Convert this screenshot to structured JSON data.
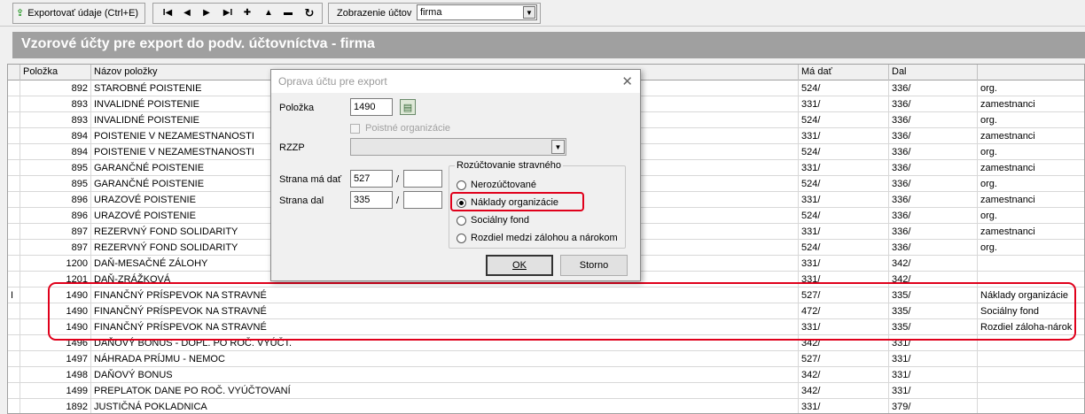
{
  "toolbar": {
    "export_label": "Exportovať údaje (Ctrl+E)",
    "nav_first": "I◀",
    "nav_prev": "◀",
    "nav_next": "▶",
    "nav_last": "▶I",
    "nav_add": "✚",
    "nav_up": "▲",
    "nav_remove": "▬",
    "nav_refresh": "↻",
    "view_label": "Zobrazenie účtov",
    "view_value": "firma"
  },
  "title": "Vzorové účty pre export do podv. účtovníctva - firma",
  "grid": {
    "headers": [
      "Položka",
      "Názov položky",
      "Má dať",
      "Dal",
      ""
    ],
    "rows": [
      {
        "marker": "",
        "item": "892",
        "name": "STAROBNÉ POISTENIE",
        "debit": "524/",
        "credit": "336/",
        "note": "org."
      },
      {
        "marker": "",
        "item": "893",
        "name": "INVALIDNÉ POISTENIE",
        "debit": "331/",
        "credit": "336/",
        "note": "zamestnanci"
      },
      {
        "marker": "",
        "item": "893",
        "name": "INVALIDNÉ POISTENIE",
        "debit": "524/",
        "credit": "336/",
        "note": "org."
      },
      {
        "marker": "",
        "item": "894",
        "name": "POISTENIE V NEZAMESTNANOSTI",
        "debit": "331/",
        "credit": "336/",
        "note": "zamestnanci"
      },
      {
        "marker": "",
        "item": "894",
        "name": "POISTENIE V NEZAMESTNANOSTI",
        "debit": "524/",
        "credit": "336/",
        "note": "org."
      },
      {
        "marker": "",
        "item": "895",
        "name": "GARANČNÉ POISTENIE",
        "debit": "331/",
        "credit": "336/",
        "note": "zamestnanci"
      },
      {
        "marker": "",
        "item": "895",
        "name": "GARANČNÉ POISTENIE",
        "debit": "524/",
        "credit": "336/",
        "note": "org."
      },
      {
        "marker": "",
        "item": "896",
        "name": "URAZOVÉ POISTENIE",
        "debit": "331/",
        "credit": "336/",
        "note": "zamestnanci"
      },
      {
        "marker": "",
        "item": "896",
        "name": "URAZOVÉ POISTENIE",
        "debit": "524/",
        "credit": "336/",
        "note": "org."
      },
      {
        "marker": "",
        "item": "897",
        "name": "REZERVNÝ FOND SOLIDARITY",
        "debit": "331/",
        "credit": "336/",
        "note": "zamestnanci"
      },
      {
        "marker": "",
        "item": "897",
        "name": "REZERVNÝ FOND SOLIDARITY",
        "debit": "524/",
        "credit": "336/",
        "note": "org."
      },
      {
        "marker": "",
        "item": "1200",
        "name": "DAŇ-MESAČNÉ ZÁLOHY",
        "debit": "331/",
        "credit": "342/",
        "note": ""
      },
      {
        "marker": "",
        "item": "1201",
        "name": "DAŇ-ZRÁŽKOVÁ",
        "debit": "331/",
        "credit": "342/",
        "note": ""
      },
      {
        "marker": "I",
        "item": "1490",
        "name": "FINANČNÝ PRÍSPEVOK NA STRAVNÉ",
        "debit": "527/",
        "credit": "335/",
        "note": "Náklady organizácie"
      },
      {
        "marker": "",
        "item": "1490",
        "name": "FINANČNÝ PRÍSPEVOK NA STRAVNÉ",
        "debit": "472/",
        "credit": "335/",
        "note": "Sociálny fond"
      },
      {
        "marker": "",
        "item": "1490",
        "name": "FINANČNÝ PRÍSPEVOK NA STRAVNÉ",
        "debit": "331/",
        "credit": "335/",
        "note": "Rozdiel záloha-nárok"
      },
      {
        "marker": "",
        "item": "1496",
        "name": "DAŇOVÝ BONUS - DOPL. PO ROČ. VYÚČT.",
        "debit": "342/",
        "credit": "331/",
        "note": ""
      },
      {
        "marker": "",
        "item": "1497",
        "name": "NÁHRADA PRÍJMU - NEMOC",
        "debit": "527/",
        "credit": "331/",
        "note": ""
      },
      {
        "marker": "",
        "item": "1498",
        "name": "DAŇOVÝ BONUS",
        "debit": "342/",
        "credit": "331/",
        "note": ""
      },
      {
        "marker": "",
        "item": "1499",
        "name": "PREPLATOK DANE PO ROČ. VYÚČTOVANÍ",
        "debit": "342/",
        "credit": "331/",
        "note": ""
      },
      {
        "marker": "",
        "item": "1892",
        "name": "JUSTIČNÁ POKLADNICA",
        "debit": "331/",
        "credit": "379/",
        "note": ""
      }
    ]
  },
  "dialog": {
    "title": "Oprava účtu pre export",
    "close": "✕",
    "item_label": "Položka",
    "item_value": "1490",
    "insurance_org_label": "Poistné organizácie",
    "rzzp_label": "RZZP",
    "debit_label": "Strana má dať",
    "debit_value": "527",
    "credit_label": "Strana dal",
    "credit_value": "335",
    "slash": "/",
    "group_title": "Rozúčtovanie stravného",
    "options": [
      "Nerozúčtované",
      "Náklady organizácie",
      "Sociálny fond",
      "Rozdiel medzi zálohou a nárokom"
    ],
    "selected_option": 1,
    "ok_label": "OK",
    "cancel_label": "Storno"
  }
}
